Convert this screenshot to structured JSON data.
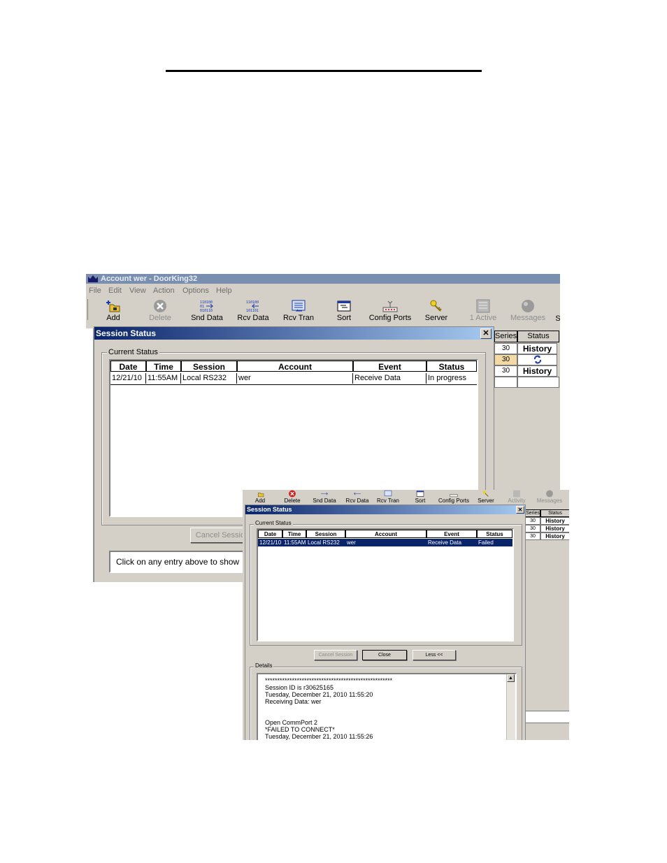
{
  "main_window": {
    "title": "Account wer - DoorKing32",
    "menu": [
      "File",
      "Edit",
      "View",
      "Action",
      "Options",
      "Help"
    ],
    "toolbar": [
      {
        "label": "Add",
        "icon": "add-folder-icon",
        "enabled": true
      },
      {
        "label": "Delete",
        "icon": "delete-icon",
        "enabled": false
      },
      {
        "label": "Snd Data",
        "icon": "send-data-icon",
        "enabled": true
      },
      {
        "label": "Rcv Data",
        "icon": "receive-data-icon",
        "enabled": true
      },
      {
        "label": "Rcv Tran",
        "icon": "receive-transaction-icon",
        "enabled": true
      },
      {
        "label": "Sort",
        "icon": "sort-icon",
        "enabled": true
      },
      {
        "label": "Config Ports",
        "icon": "config-ports-icon",
        "enabled": true
      },
      {
        "label": "Server",
        "icon": "server-key-icon",
        "enabled": true
      },
      {
        "label": "1 Active",
        "icon": "activity-icon",
        "enabled": false
      },
      {
        "label": "Messages",
        "icon": "messages-icon",
        "enabled": false
      },
      {
        "label": "S",
        "icon": "",
        "enabled": true
      }
    ],
    "background_table": {
      "headers": [
        "Series",
        "Status"
      ],
      "rows": [
        {
          "series": "30",
          "status": "History"
        },
        {
          "series": "30",
          "status": "refresh-icon"
        },
        {
          "series": "30",
          "status": "History"
        }
      ]
    },
    "dialog": {
      "title": "Session Status",
      "close": "✕",
      "group_label": "Current Status",
      "columns": [
        "Date",
        "Time",
        "Session",
        "Account",
        "Event",
        "Status"
      ],
      "rows": [
        {
          "date": "12/21/10",
          "time": "11:55AM",
          "session": "Local RS232",
          "account": "wer",
          "event": "Receive Data",
          "status": "In progress"
        }
      ],
      "cancel_button": "Cancel Session",
      "info_text": "Click on any entry above to show"
    }
  },
  "second_window": {
    "toolbar": [
      {
        "label": "Add",
        "icon": "add-folder-icon",
        "enabled": true
      },
      {
        "label": "Delete",
        "icon": "delete-icon",
        "enabled": true
      },
      {
        "label": "Snd Data",
        "icon": "send-data-icon",
        "enabled": true
      },
      {
        "label": "Rcv Data",
        "icon": "receive-data-icon",
        "enabled": true
      },
      {
        "label": "Rcv Tran",
        "icon": "receive-transaction-icon",
        "enabled": true
      },
      {
        "label": "Sort",
        "icon": "sort-icon",
        "enabled": true
      },
      {
        "label": "Config Ports",
        "icon": "config-ports-icon",
        "enabled": true
      },
      {
        "label": "Server",
        "icon": "server-key-icon",
        "enabled": true
      },
      {
        "label": "Activity",
        "icon": "activity-icon",
        "enabled": false
      },
      {
        "label": "Messages",
        "icon": "messages-icon",
        "enabled": false
      }
    ],
    "background_table": {
      "headers": [
        "Series",
        "Status"
      ],
      "rows": [
        {
          "series": "30",
          "status": "History"
        },
        {
          "series": "30",
          "status": "History"
        },
        {
          "series": "30",
          "status": "History"
        }
      ]
    },
    "dialog": {
      "title": "Session Status",
      "close": "✕",
      "group_label": "Current Status",
      "columns": [
        "Date",
        "Time",
        "Session",
        "Account",
        "Event",
        "Status"
      ],
      "rows": [
        {
          "date": "12/21/10",
          "time": "11:55AM",
          "session": "Local RS232",
          "account": "wer",
          "event": "Receive Data",
          "status": "Failed"
        }
      ],
      "buttons": {
        "cancel": "Cancel Session",
        "close": "Close",
        "less": "Less <<"
      },
      "details_label": "Details",
      "details_lines": [
        "****************************************************",
        "Session ID is r30625165",
        "Tuesday, December 21, 2010 11:55:20",
        "Receiving Data: wer",
        "",
        "",
        "Open CommPort 2",
        "*FAILED TO CONNECT*",
        "Tuesday, December 21, 2010 11:55:26"
      ]
    }
  },
  "colors": {
    "window_bg": "#d4d0c8",
    "title_active_start": "#0a246a",
    "title_active_end": "#a6caf0",
    "title_inactive": "#7a8fb0",
    "selection": "#0a246a",
    "highlight_cell": "#f3d9a4"
  }
}
